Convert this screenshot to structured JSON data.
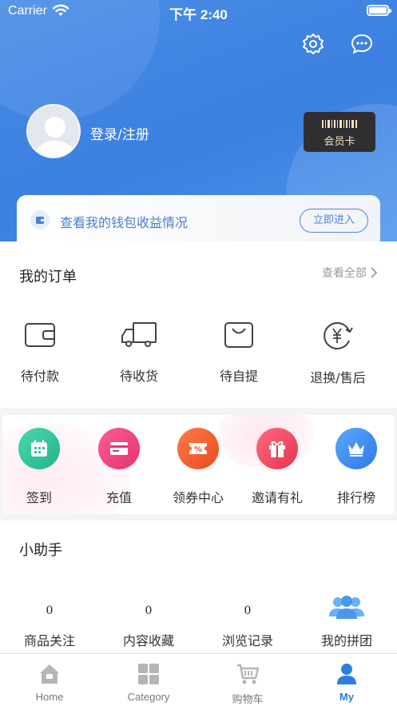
{
  "status_bar": {
    "carrier": "Carrier",
    "time": "下午 2:40"
  },
  "header": {
    "login_label": "登录/注册",
    "vip_card_label": "会员卡"
  },
  "wallet": {
    "text": "查看我的钱包收益情况",
    "button": "立即进入"
  },
  "orders": {
    "title": "我的订单",
    "view_all": "查看全部",
    "items": [
      {
        "label": "待付款",
        "icon": "wallet-icon"
      },
      {
        "label": "待收货",
        "icon": "truck-icon"
      },
      {
        "label": "待自提",
        "icon": "bag-icon"
      },
      {
        "label": "退换/售后",
        "icon": "yen-refund-icon"
      }
    ]
  },
  "services": [
    {
      "label": "签到",
      "icon": "calendar-icon",
      "color": "#2fc59a"
    },
    {
      "label": "充值",
      "icon": "card-icon",
      "color": "#f0467e"
    },
    {
      "label": "领券中心",
      "icon": "coupon-icon",
      "color": "#f5592f"
    },
    {
      "label": "邀请有礼",
      "icon": "gift-icon",
      "color": "#f24d64"
    },
    {
      "label": "排行榜",
      "icon": "crown-icon",
      "color": "#3f8ef0"
    }
  ],
  "helper": {
    "title": "小助手",
    "items": [
      {
        "count": "0",
        "label": "商品关注"
      },
      {
        "count": "0",
        "label": "内容收藏"
      },
      {
        "count": "0",
        "label": "浏览记录"
      },
      {
        "label": "我的拼团",
        "icon": "group-icon"
      }
    ]
  },
  "tabbar": [
    {
      "label": "Home",
      "icon": "home-icon"
    },
    {
      "label": "Category",
      "icon": "category-icon"
    },
    {
      "label": "购物车",
      "icon": "cart-icon"
    },
    {
      "label": "My",
      "icon": "user-icon",
      "active": true
    }
  ],
  "colors": {
    "header_blue": "#3b7fe0",
    "accent": "#2f7ddc"
  }
}
